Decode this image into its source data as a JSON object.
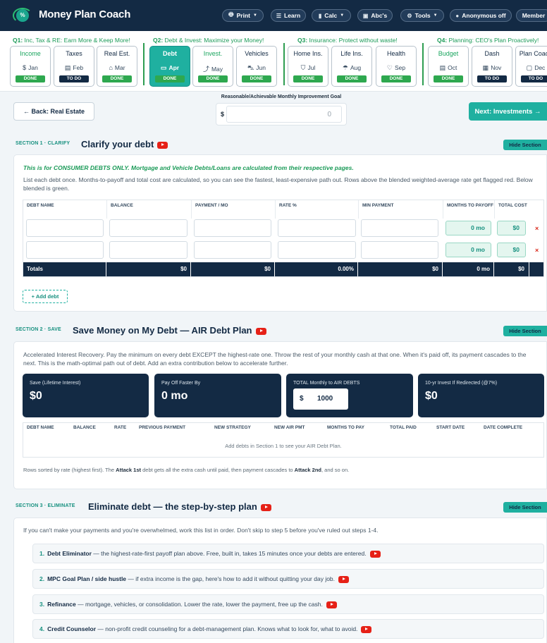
{
  "app": {
    "title": "Money Plan Coach",
    "logo_text": "%"
  },
  "toolbar": [
    {
      "label": "Print",
      "icon": "printer-icon",
      "glyph": "🖶",
      "caret": true
    },
    {
      "label": "Learn",
      "icon": "list-icon",
      "glyph": "☰",
      "caret": false
    },
    {
      "label": "Calc",
      "icon": "calculator-icon",
      "glyph": "▮",
      "caret": true
    },
    {
      "label": "Abc's",
      "icon": "book-icon",
      "glyph": "▣",
      "caret": false
    },
    {
      "label": "Tools",
      "icon": "gear-icon",
      "glyph": "⚙",
      "caret": true
    },
    {
      "label": "Anonymous off",
      "icon": "dot-icon",
      "glyph": "●",
      "caret": false
    },
    {
      "label": "Member",
      "icon": "",
      "glyph": "",
      "caret": false
    }
  ],
  "quarters": [
    {
      "bold": "Q1:",
      "text": " Inc, Tax & RE: Earn More & Keep More!"
    },
    {
      "bold": "Q2:",
      "text": " Debt & Invest: Maximize your Money!"
    },
    {
      "bold": "Q3:",
      "text": " Insurance: Protect without waste!"
    },
    {
      "bold": "Q4:",
      "text": " Planning: CEO's Plan Proactively!"
    }
  ],
  "tiles": [
    {
      "name": "Income",
      "month": "Jan",
      "icon": "dollar-icon",
      "glyph": "$",
      "status": "DONE",
      "green_name": true
    },
    {
      "name": "Taxes",
      "month": "Feb",
      "icon": "receipt-icon",
      "glyph": "▤",
      "status": "TO DO"
    },
    {
      "name": "Real Est.",
      "month": "Mar",
      "icon": "home-icon",
      "glyph": "⌂",
      "status": "DONE"
    },
    {
      "name": "Debt",
      "month": "Apr",
      "icon": "credit-card-icon",
      "glyph": "▭",
      "status": "DONE",
      "active": true
    },
    {
      "name": "Invest.",
      "month": "May",
      "icon": "trending-up-icon",
      "glyph": "⤴",
      "status": "DONE",
      "green_name": true
    },
    {
      "name": "Vehicles",
      "month": "Jun",
      "icon": "car-icon",
      "glyph": "⛍",
      "status": "DONE"
    },
    {
      "name": "Home Ins.",
      "month": "Jul",
      "icon": "shield-icon",
      "glyph": "⛉",
      "status": "DONE"
    },
    {
      "name": "Life Ins.",
      "month": "Aug",
      "icon": "umbrella-icon",
      "glyph": "☂",
      "status": "DONE"
    },
    {
      "name": "Health",
      "month": "Sep",
      "icon": "heart-icon",
      "glyph": "♡",
      "status": "DONE"
    },
    {
      "name": "Budget",
      "month": "Oct",
      "icon": "document-icon",
      "glyph": "▤",
      "status": "DONE",
      "green_name": true
    },
    {
      "name": "Dash",
      "month": "Nov",
      "icon": "dashboard-icon",
      "glyph": "▦",
      "status": "TO DO"
    },
    {
      "name": "Plan Coach",
      "month": "Dec",
      "icon": "chat-icon",
      "glyph": "▢",
      "status": "TO DO"
    }
  ],
  "nav": {
    "back": "← Back: Real Estate",
    "next": "Next: Investments →"
  },
  "goal": {
    "label": "Reasonable/Achievable Monthly Improvement Goal",
    "currency": "$",
    "value": "0"
  },
  "hide_label": "Hide Section",
  "section1": {
    "label": "SECTION 1 · CLARIFY",
    "title": "Clarify your debt",
    "note": "This is for CONSUMER DEBTS ONLY. Mortgage and Vehicle Debts/Loans are calculated from their respective pages.",
    "desc": "List each debt once. Months-to-payoff and total cost are calculated, so you can see the fastest, least-expensive path out. Rows above the blended weighted-average rate get flagged red. Below blended is green.",
    "headers": [
      "DEBT NAME",
      "BALANCE",
      "PAYMENT / MO",
      "RATE %",
      "MIN PAYMENT",
      "MONTHS TO PAYOFF",
      "TOTAL COST"
    ],
    "rows": [
      {
        "months": "0 mo",
        "cost": "$0"
      },
      {
        "months": "0 mo",
        "cost": "$0"
      }
    ],
    "delete_glyph": "×",
    "totals": [
      "Totals",
      "$0",
      "$0",
      "0.00%",
      "$0",
      "0 mo",
      "$0"
    ],
    "add": "+ Add debt"
  },
  "section2": {
    "label": "SECTION 2 · SAVE",
    "title": "Save Money on My Debt — AIR Debt Plan",
    "desc": "Accelerated Interest Recovery. Pay the minimum on every debt EXCEPT the highest-rate one. Throw the rest of your monthly cash at that one. When it's paid off, its payment cascades to the next. This is the math-optimal path out of debt. Add an extra contribution below to accelerate further.",
    "stats": [
      {
        "label": "Save (Lifetime Interest)",
        "value": "$0"
      },
      {
        "label": "Pay Off Faster By",
        "value": "0 mo"
      },
      {
        "label": "TOTAL Monthly to AIR DEBTS",
        "currency": "$",
        "value": "1000"
      },
      {
        "label": "10-yr Invest If Redirected (@7%)",
        "value": "$0"
      }
    ],
    "headers": [
      "DEBT NAME",
      "BALANCE",
      "RATE",
      "PREVIOUS PAYMENT",
      "NEW STRATEGY",
      "NEW AIR PMT",
      "MONTHS TO PAY",
      "TOTAL PAID",
      "START DATE",
      "DATE COMPLETE"
    ],
    "empty": "Add debts in Section 1 to see your AIR Debt Plan.",
    "foot": {
      "t1": "Rows sorted by rate (highest first). The ",
      "b1": "Attack 1st",
      "t2": " debt gets all the extra cash until paid, then payment cascades to ",
      "b2": "Attack 2nd",
      "t3": ", and so on."
    }
  },
  "section3": {
    "label": "SECTION 3 · ELIMINATE",
    "title": "Eliminate debt — the step-by-step plan",
    "desc": "If you can't make your payments and you're overwhelmed, work this list in order. Don't skip to step 5 before you've ruled out steps 1-4.",
    "steps": [
      {
        "num": "1.",
        "title": "Debt Eliminator",
        "text": " — the highest-rate-first payoff plan above. Free, built in, takes 15 minutes once your debts are entered."
      },
      {
        "num": "2.",
        "title": "MPC Goal Plan / side hustle",
        "text": " — if extra income is the gap, here's how to add it without quitting your day job."
      },
      {
        "num": "3.",
        "title": "Refinance",
        "text": " — mortgage, vehicles, or consolidation. Lower the rate, lower the payment, free up the cash."
      },
      {
        "num": "4.",
        "title": "Credit Counselor",
        "text": " — non-profit credit counseling for a debt-management plan. Knows what to look for, what to avoid."
      }
    ]
  }
}
